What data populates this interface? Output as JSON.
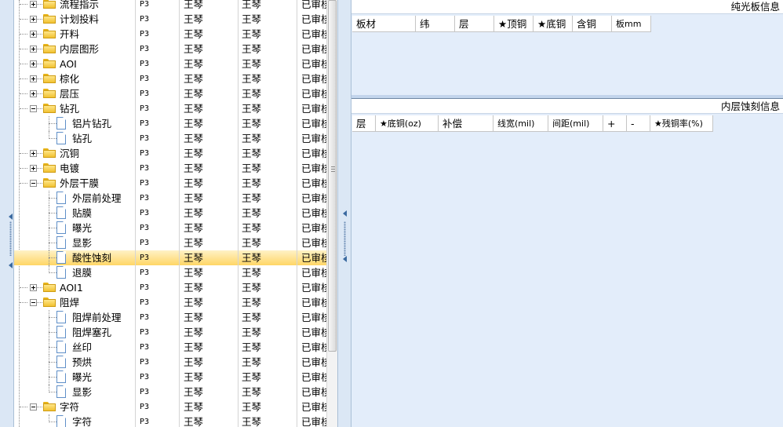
{
  "tree": {
    "rows": [
      {
        "name": "流程指示",
        "code": "P3",
        "person1": "王琴",
        "person2": "王琴",
        "status": "已审核",
        "type": "folder",
        "level": 0,
        "expander": "plus"
      },
      {
        "name": "计划投料",
        "code": "P3",
        "person1": "王琴",
        "person2": "王琴",
        "status": "已审核",
        "type": "folder",
        "level": 0,
        "expander": "plus"
      },
      {
        "name": "开料",
        "code": "P3",
        "person1": "王琴",
        "person2": "王琴",
        "status": "已审核",
        "type": "folder",
        "level": 0,
        "expander": "plus"
      },
      {
        "name": "内层图形",
        "code": "P3",
        "person1": "王琴",
        "person2": "王琴",
        "status": "已审核",
        "type": "folder",
        "level": 0,
        "expander": "plus"
      },
      {
        "name": "AOI",
        "code": "P3",
        "person1": "王琴",
        "person2": "王琴",
        "status": "已审核",
        "type": "folder",
        "level": 0,
        "expander": "plus"
      },
      {
        "name": "棕化",
        "code": "P3",
        "person1": "王琴",
        "person2": "王琴",
        "status": "已审核",
        "type": "folder",
        "level": 0,
        "expander": "plus"
      },
      {
        "name": "层压",
        "code": "P3",
        "person1": "王琴",
        "person2": "王琴",
        "status": "已审核",
        "type": "folder",
        "level": 0,
        "expander": "plus"
      },
      {
        "name": "钻孔",
        "code": "P3",
        "person1": "王琴",
        "person2": "王琴",
        "status": "已审核",
        "type": "folder",
        "level": 0,
        "expander": "minus"
      },
      {
        "name": "铝片钻孔",
        "code": "P3",
        "person1": "王琴",
        "person2": "王琴",
        "status": "已审核",
        "type": "doc",
        "level": 1
      },
      {
        "name": "钻孔",
        "code": "P3",
        "person1": "王琴",
        "person2": "王琴",
        "status": "已审核",
        "type": "doc",
        "level": 1
      },
      {
        "name": "沉铜",
        "code": "P3",
        "person1": "王琴",
        "person2": "王琴",
        "status": "已审核",
        "type": "folder",
        "level": 0,
        "expander": "plus"
      },
      {
        "name": "电镀",
        "code": "P3",
        "person1": "王琴",
        "person2": "王琴",
        "status": "已审核",
        "type": "folder",
        "level": 0,
        "expander": "plus"
      },
      {
        "name": "外层干膜",
        "code": "P3",
        "person1": "王琴",
        "person2": "王琴",
        "status": "已审核",
        "type": "folder",
        "level": 0,
        "expander": "minus"
      },
      {
        "name": "外层前处理",
        "code": "P3",
        "person1": "王琴",
        "person2": "王琴",
        "status": "已审核",
        "type": "doc",
        "level": 1
      },
      {
        "name": "贴膜",
        "code": "P3",
        "person1": "王琴",
        "person2": "王琴",
        "status": "已审核",
        "type": "doc",
        "level": 1
      },
      {
        "name": "曝光",
        "code": "P3",
        "person1": "王琴",
        "person2": "王琴",
        "status": "已审核",
        "type": "doc",
        "level": 1
      },
      {
        "name": "显影",
        "code": "P3",
        "person1": "王琴",
        "person2": "王琴",
        "status": "已审核",
        "type": "doc",
        "level": 1
      },
      {
        "name": "酸性蚀刻",
        "code": "P3",
        "person1": "王琴",
        "person2": "王琴",
        "status": "已审核",
        "type": "doc",
        "level": 1,
        "selected": true
      },
      {
        "name": "退膜",
        "code": "P3",
        "person1": "王琴",
        "person2": "王琴",
        "status": "已审核",
        "type": "doc",
        "level": 1
      },
      {
        "name": "AOI1",
        "code": "P3",
        "person1": "王琴",
        "person2": "王琴",
        "status": "已审核",
        "type": "folder",
        "level": 0,
        "expander": "plus"
      },
      {
        "name": "阻焊",
        "code": "P3",
        "person1": "王琴",
        "person2": "王琴",
        "status": "已审核",
        "type": "folder",
        "level": 0,
        "expander": "minus"
      },
      {
        "name": "阻焊前处理",
        "code": "P3",
        "person1": "王琴",
        "person2": "王琴",
        "status": "已审核",
        "type": "doc",
        "level": 1
      },
      {
        "name": "阻焊塞孔",
        "code": "P3",
        "person1": "王琴",
        "person2": "王琴",
        "status": "已审核",
        "type": "doc",
        "level": 1
      },
      {
        "name": "丝印",
        "code": "P3",
        "person1": "王琴",
        "person2": "王琴",
        "status": "已审核",
        "type": "doc",
        "level": 1
      },
      {
        "name": "预烘",
        "code": "P3",
        "person1": "王琴",
        "person2": "王琴",
        "status": "已审核",
        "type": "doc",
        "level": 1
      },
      {
        "name": "曝光",
        "code": "P3",
        "person1": "王琴",
        "person2": "王琴",
        "status": "已审核",
        "type": "doc",
        "level": 1
      },
      {
        "name": "显影",
        "code": "P3",
        "person1": "王琴",
        "person2": "王琴",
        "status": "已审核",
        "type": "doc",
        "level": 1
      },
      {
        "name": "字符",
        "code": "P3",
        "person1": "王琴",
        "person2": "王琴",
        "status": "已审核",
        "type": "folder",
        "level": 0,
        "expander": "minus"
      },
      {
        "name": "字符",
        "code": "P3",
        "person1": "王琴",
        "person2": "王琴",
        "status": "已审核",
        "type": "doc",
        "level": 1
      }
    ]
  },
  "panels": {
    "top": {
      "title": "纯光板信息",
      "columns": [
        "板材",
        "纬",
        "层",
        "★顶铜",
        "★底铜",
        "含铜",
        "板mm"
      ]
    },
    "bottom": {
      "title": "内层蚀刻信息",
      "columns": [
        "层",
        "★底铜(oz)",
        "补偿",
        "线宽(mil)",
        "间距(mil)",
        "+",
        "-",
        "★残铜率(%)"
      ]
    }
  },
  "colors": {
    "selected_row_top": "#fff2c6",
    "selected_row_bottom": "#ffd666",
    "panel_background": "#e3edfa",
    "splitter": "#dbe7f5",
    "folder": "#f1c232"
  },
  "icons": {
    "folder": "folder-icon",
    "document": "document-icon",
    "expand": "expand-plus-icon",
    "collapse": "collapse-minus-icon",
    "splitter_arrow": "chevron-left-icon"
  }
}
